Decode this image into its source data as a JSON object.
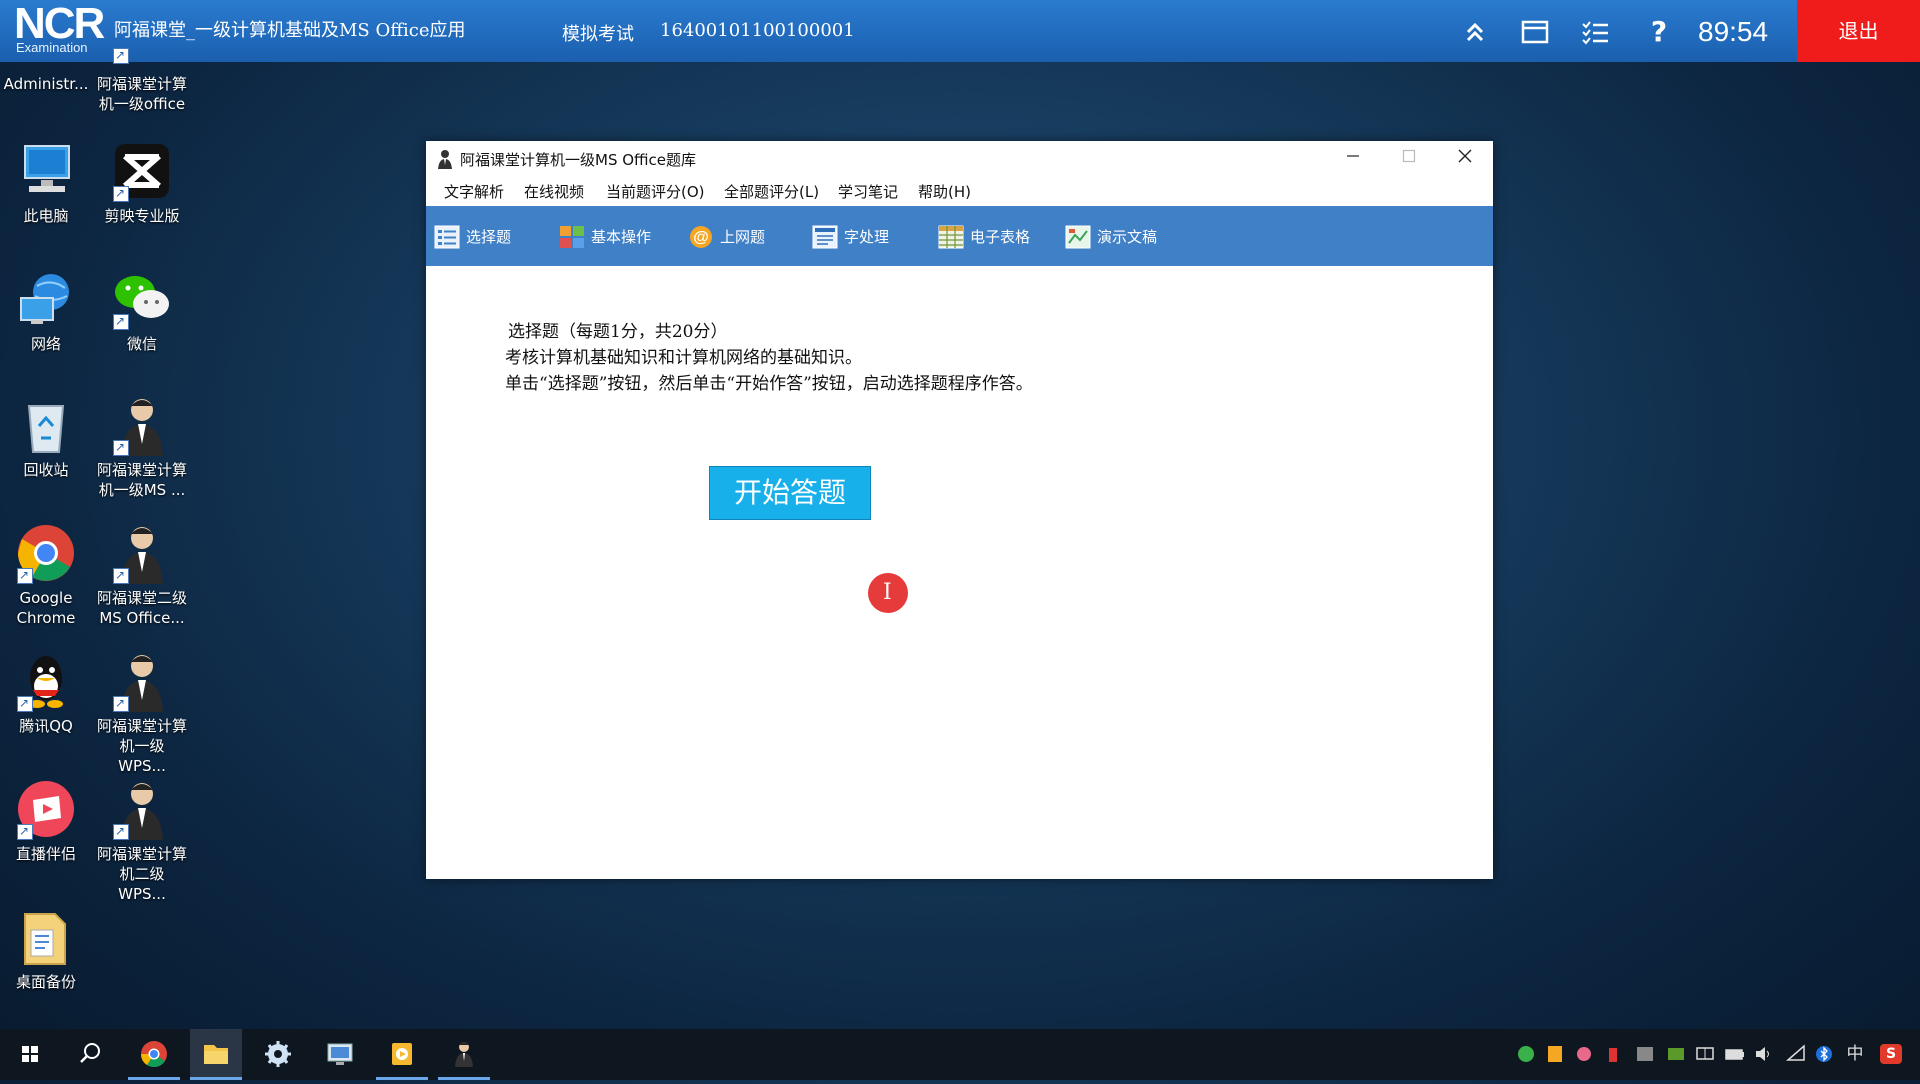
{
  "topbar": {
    "logo_main": "NCR",
    "logo_sub": "Examination",
    "course_title": "阿福课堂_一级计算机基础及MS Office应用",
    "mode": "模拟考试",
    "exam_number": "16400101100100001",
    "timer": "89:54",
    "exit_label": "退出",
    "icons": [
      "collapse-icon",
      "window-icon",
      "list-icon",
      "help-icon"
    ]
  },
  "desktop": {
    "icons": [
      {
        "label": "Administr...",
        "icon": "user-folder-icon"
      },
      {
        "label": "阿福课堂计算机一级office",
        "icon": "app-shortcut-icon"
      },
      {
        "label": "此电脑",
        "icon": "computer-icon"
      },
      {
        "label": "剪映专业版",
        "icon": "capcut-icon"
      },
      {
        "label": "网络",
        "icon": "network-icon"
      },
      {
        "label": "微信",
        "icon": "wechat-icon"
      },
      {
        "label": "回收站",
        "icon": "recycle-bin-icon"
      },
      {
        "label": "阿福课堂计算机一级MS ...",
        "icon": "person-icon"
      },
      {
        "label": "Google Chrome",
        "icon": "chrome-icon"
      },
      {
        "label": "阿福课堂二级MS Office...",
        "icon": "person-icon"
      },
      {
        "label": "腾讯QQ",
        "icon": "qq-icon"
      },
      {
        "label": "阿福课堂计算机一级WPS...",
        "icon": "person-icon"
      },
      {
        "label": "直播伴侣",
        "icon": "live-icon"
      },
      {
        "label": "阿福课堂计算机二级WPS...",
        "icon": "person-icon"
      },
      {
        "label": "桌面备份",
        "icon": "folder-icon"
      }
    ]
  },
  "window": {
    "title": "阿福课堂计算机一级MS Office题库",
    "menu": [
      "文字解析",
      "在线视频",
      "当前题评分(O)",
      "全部题评分(L)",
      "学习笔记",
      "帮助(H)"
    ],
    "toolbar": [
      "选择题",
      "基本操作",
      "上网题",
      "字处理",
      "电子表格",
      "演示文稿"
    ],
    "content": {
      "line1": "选择题（每题1分，共20分）",
      "line2": "考核计算机基础知识和计算机网络的基础知识。",
      "line3": "单击“选择题”按钮，然后单击“开始作答”按钮，启动选择题程序作答。",
      "start_button": "开始答题"
    }
  },
  "taskbar": {
    "apps": [
      "start-icon",
      "search-icon",
      "chrome-icon",
      "file-explorer-icon",
      "settings-gear-icon",
      "screen-icon",
      "player-icon",
      "person-icon"
    ],
    "tray": [
      "app-icon",
      "app-icon",
      "app-icon",
      "app-icon",
      "app-icon",
      "nvidia-icon",
      "display-icon",
      "battery-icon",
      "volume-icon",
      "wifi-icon",
      "bluetooth-icon"
    ],
    "ime": "中",
    "ime2": "S"
  },
  "colors": {
    "topbar": "#1b5fae",
    "exit": "#f01b1b",
    "toolbar": "#3f80c6",
    "start_button": "#18b0ea"
  }
}
